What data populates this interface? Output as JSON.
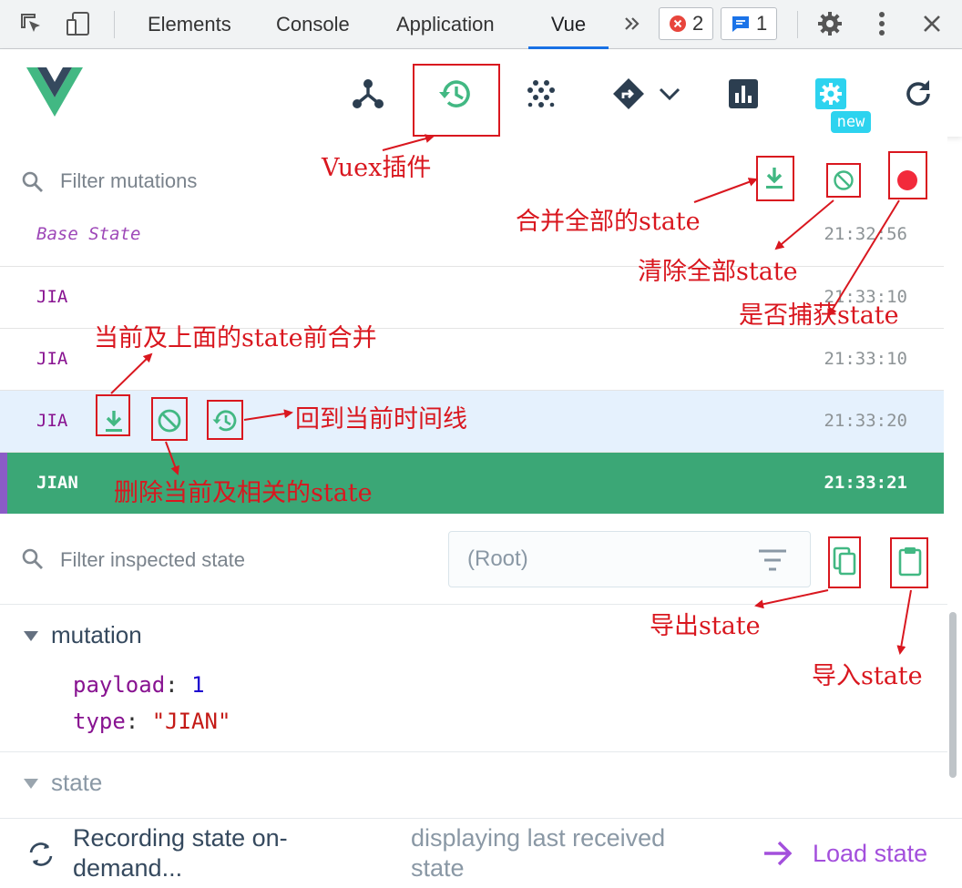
{
  "devtools": {
    "tabs": [
      "Elements",
      "Console",
      "Application",
      "Vue"
    ],
    "active_tab": "Vue",
    "more_tabs_icon": "double-chevron-right-icon",
    "error_count": "2",
    "message_count": "1"
  },
  "vue_toolbar": {
    "buttons": [
      "components-tree-icon",
      "vuex-history-icon",
      "events-icon",
      "routing-icon",
      "performance-chart-icon",
      "settings-icon",
      "refresh-icon"
    ],
    "settings_badge": "new"
  },
  "mutations": {
    "filter_placeholder": "Filter mutations",
    "rows": [
      {
        "name": "Base State",
        "time": "21:32:56",
        "state": "base"
      },
      {
        "name": "JIA",
        "time": "21:33:10",
        "state": "normal"
      },
      {
        "name": "JIA",
        "time": "21:33:10",
        "state": "normal"
      },
      {
        "name": "JIA",
        "time": "21:33:20",
        "state": "hover"
      },
      {
        "name": "JIAN",
        "time": "21:33:21",
        "state": "selected"
      }
    ]
  },
  "inspector": {
    "filter_placeholder": "Filter inspected state",
    "root_select_value": "(Root)",
    "mutation_section": "mutation",
    "payload_key": "payload",
    "payload_value": "1",
    "type_key": "type",
    "type_value": "\"JIAN\"",
    "state_section": "state"
  },
  "bottom_bar": {
    "recording_text": "Recording state on-demand...",
    "displaying_text": "displaying last received state",
    "load_state_label": "Load state"
  },
  "annotations": {
    "vuex_plugin": "Vuex插件",
    "merge_all_state": "合并全部的state",
    "clear_all_state": "清除全部state",
    "capture_state": "是否捕获state",
    "merge_current_above": "当前及上面的state前合并",
    "back_to_timeline": "回到当前时间线",
    "delete_current_related": "删除当前及相关的state",
    "export_state": "导出state",
    "import_state": "导入state"
  },
  "colors": {
    "vue_green": "#42b883",
    "vue_dark": "#35495e",
    "selected_row": "#3ba776",
    "annotation_red": "#d9171f",
    "load_state_purple": "#a34fdc"
  }
}
